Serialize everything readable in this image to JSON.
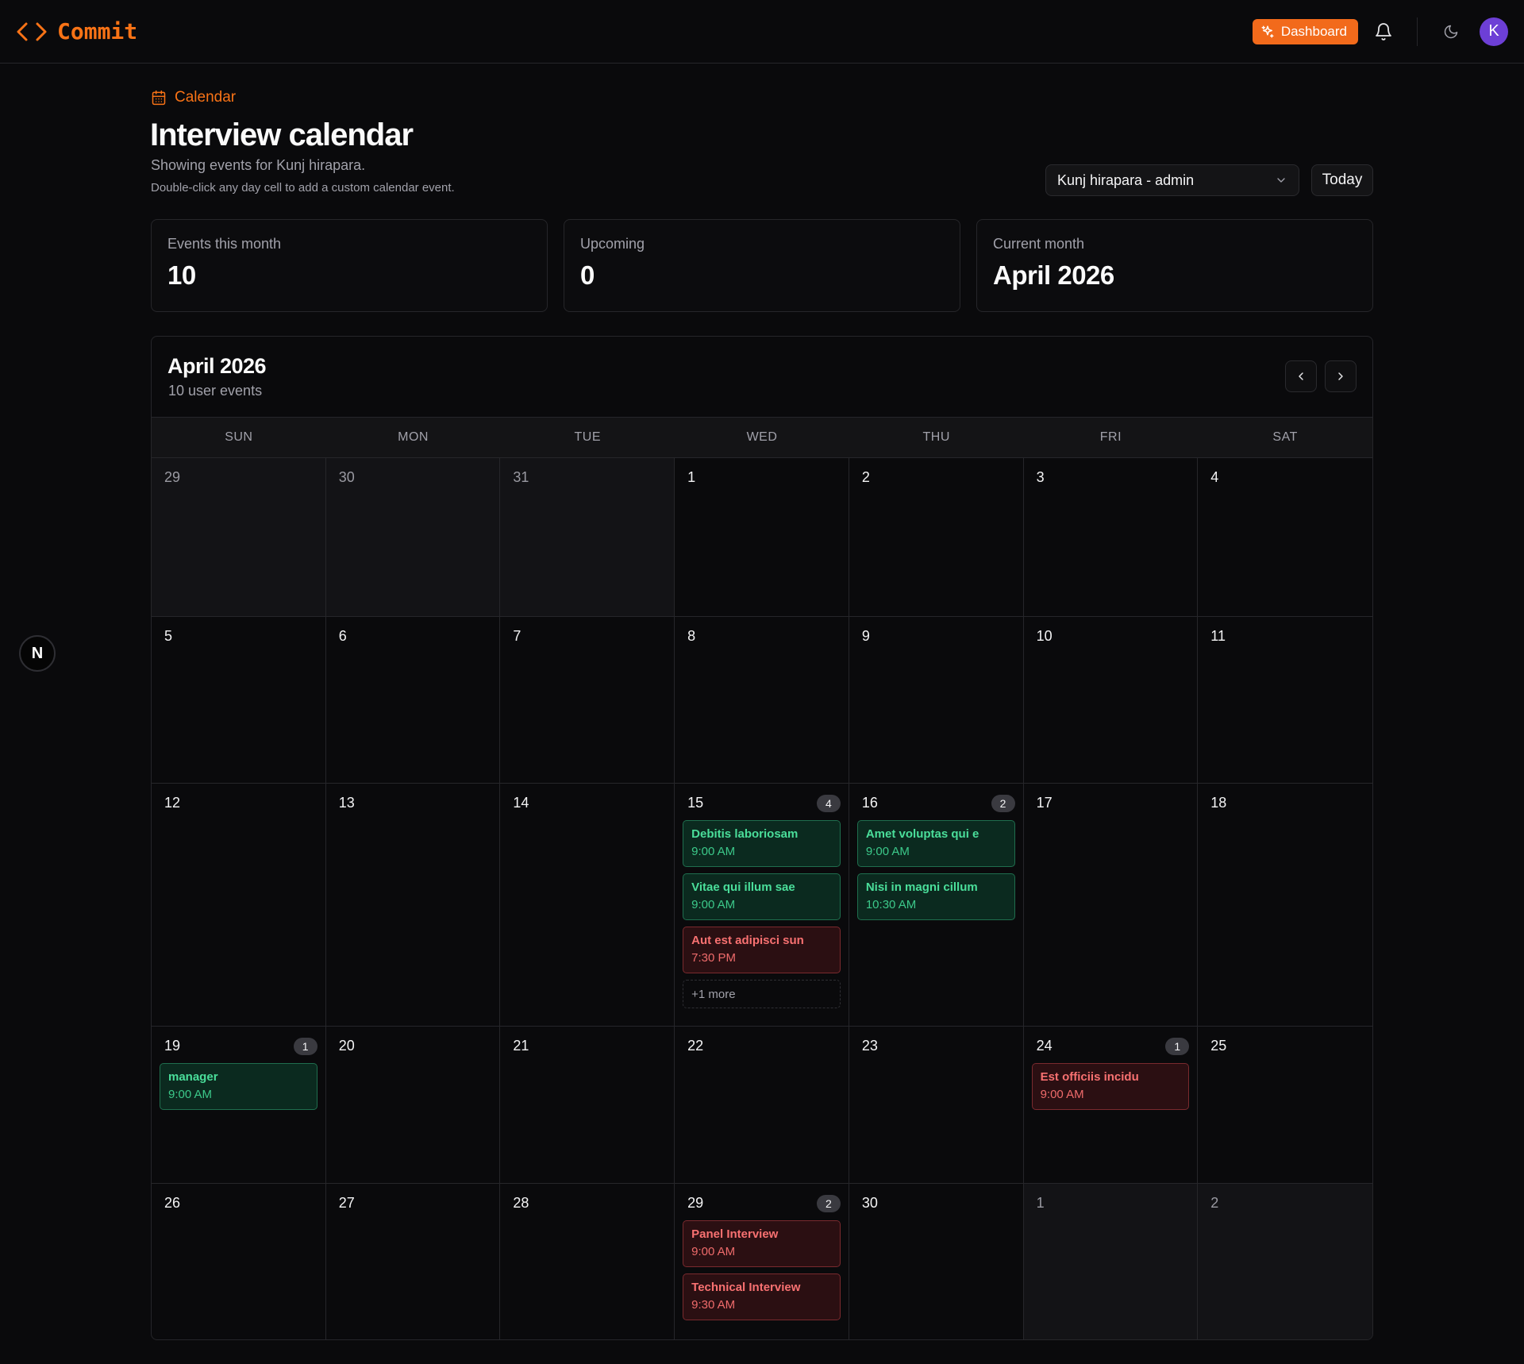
{
  "app": {
    "brand": "Commit",
    "dashboard_label": "Dashboard",
    "avatar_initial": "K",
    "accent": "#f97316"
  },
  "header": {
    "breadcrumb": "Calendar",
    "title": "Interview calendar",
    "subtitle": "Showing events for Kunj hirapara.",
    "hint": "Double-click any day cell to add a custom calendar event.",
    "user_select_value": "Kunj hirapara - admin",
    "today_label": "Today"
  },
  "stats": [
    {
      "label": "Events this month",
      "value": "10"
    },
    {
      "label": "Upcoming",
      "value": "0"
    },
    {
      "label": "Current month",
      "value": "April 2026"
    }
  ],
  "calendar": {
    "title": "April 2026",
    "count_label": "10 user events",
    "weekdays": [
      "SUN",
      "MON",
      "TUE",
      "WED",
      "THU",
      "FRI",
      "SAT"
    ],
    "weeks": [
      [
        {
          "day": "29",
          "out": true
        },
        {
          "day": "30",
          "out": true
        },
        {
          "day": "31",
          "out": true
        },
        {
          "day": "1"
        },
        {
          "day": "2"
        },
        {
          "day": "3"
        },
        {
          "day": "4"
        }
      ],
      [
        {
          "day": "5"
        },
        {
          "day": "6"
        },
        {
          "day": "7"
        },
        {
          "day": "8"
        },
        {
          "day": "9"
        },
        {
          "day": "10"
        },
        {
          "day": "11"
        }
      ],
      [
        {
          "day": "12"
        },
        {
          "day": "13"
        },
        {
          "day": "14"
        },
        {
          "day": "15",
          "count": "4",
          "events": [
            {
              "title": "Debitis laboriosam",
              "time": "9:00 AM",
              "color": "green"
            },
            {
              "title": "Vitae qui illum sae",
              "time": "9:00 AM",
              "color": "green"
            },
            {
              "title": "Aut est adipisci sun",
              "time": "7:30 PM",
              "color": "red"
            }
          ],
          "more": "+1 more"
        },
        {
          "day": "16",
          "count": "2",
          "events": [
            {
              "title": "Amet voluptas qui e",
              "time": "9:00 AM",
              "color": "green"
            },
            {
              "title": "Nisi in magni cillum",
              "time": "10:30 AM",
              "color": "green"
            }
          ]
        },
        {
          "day": "17"
        },
        {
          "day": "18"
        }
      ],
      [
        {
          "day": "19",
          "count": "1",
          "events": [
            {
              "title": "manager",
              "time": "9:00 AM",
              "color": "green"
            }
          ]
        },
        {
          "day": "20"
        },
        {
          "day": "21"
        },
        {
          "day": "22"
        },
        {
          "day": "23"
        },
        {
          "day": "24",
          "count": "1",
          "events": [
            {
              "title": "Est officiis incidu",
              "time": "9:00 AM",
              "color": "red"
            }
          ]
        },
        {
          "day": "25"
        }
      ],
      [
        {
          "day": "26"
        },
        {
          "day": "27"
        },
        {
          "day": "28"
        },
        {
          "day": "29",
          "count": "2",
          "events": [
            {
              "title": "Panel Interview",
              "time": "9:00 AM",
              "color": "red"
            },
            {
              "title": "Technical Interview",
              "time": "9:30 AM",
              "color": "red"
            }
          ]
        },
        {
          "day": "30"
        },
        {
          "day": "1",
          "out": true
        },
        {
          "day": "2",
          "out": true
        }
      ]
    ]
  },
  "floating_badge": "N"
}
